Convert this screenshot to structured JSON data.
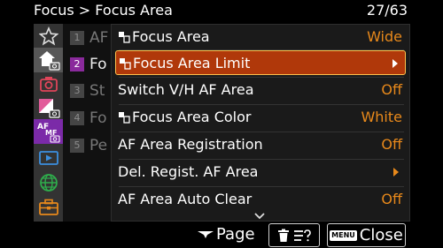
{
  "header": {
    "breadcrumb": "Focus > Focus Area",
    "page_counter": "27/63"
  },
  "sidebar": {
    "tabs": [
      {
        "icon": "star-icon"
      },
      {
        "icon": "home-camera-icon"
      },
      {
        "icon": "camera-icon"
      },
      {
        "icon": "exposure-camera-icon"
      },
      {
        "icon": "af-mf-camera-icon",
        "text_top": "AF",
        "text_bottom": "MF"
      },
      {
        "icon": "playback-icon"
      },
      {
        "icon": "network-globe-icon"
      },
      {
        "icon": "toolbox-icon"
      }
    ]
  },
  "background_list": [
    {
      "num": "1",
      "text": "AF"
    },
    {
      "num": "2",
      "text": "Fo"
    },
    {
      "num": "3",
      "text": "St"
    },
    {
      "num": "4",
      "text": "Fo"
    },
    {
      "num": "5",
      "text": "Pe"
    }
  ],
  "menu": {
    "items": [
      {
        "label": "Focus Area",
        "value": "Wide"
      },
      {
        "label": "Focus Area Limit",
        "value": ""
      },
      {
        "label": "Switch V/H AF Area",
        "value": "Off"
      },
      {
        "label": "Focus Area Color",
        "value": "White"
      },
      {
        "label": "AF Area Registration",
        "value": "Off"
      },
      {
        "label": "Del. Regist. AF Area",
        "value": ""
      },
      {
        "label": "AF Area Auto Clear",
        "value": "Off"
      }
    ]
  },
  "footer": {
    "page_label": "Page",
    "menu_badge": "MENU",
    "close_label": "Close"
  },
  "colors": {
    "accent_value": "#e8891b",
    "highlight_bg": "#b0380a",
    "highlight_border": "#ffc14d",
    "af_tab": "#7b2aa8"
  }
}
